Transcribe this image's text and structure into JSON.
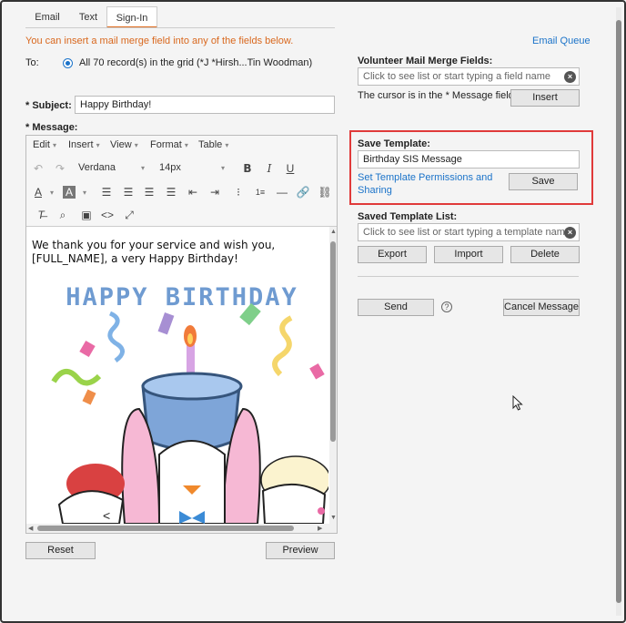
{
  "tabs": [
    {
      "label": "Email"
    },
    {
      "label": "Text"
    },
    {
      "label": "Sign-In"
    }
  ],
  "notice": "You can insert a mail merge field into any of the fields below.",
  "email_queue": "Email Queue",
  "to": {
    "label": "To:",
    "recipients": "All 70 record(s) in the grid (*J *Hirsh...Tin Woodman)"
  },
  "subject": {
    "label": "* Subject:",
    "value": "Happy Birthday!"
  },
  "message": {
    "label": "* Message:",
    "menus": [
      "Edit",
      "Insert",
      "View",
      "Format",
      "Table"
    ],
    "font_family": "Verdana",
    "font_size": "14px",
    "body_text": "We thank you for your service and wish you, [FULL_NAME], a very Happy Birthday!",
    "image_caption": "HAPPY BIRTHDAY"
  },
  "buttons": {
    "reset": "Reset",
    "preview": "Preview",
    "insert": "Insert",
    "save": "Save",
    "export": "Export",
    "import": "Import",
    "delete": "Delete",
    "send": "Send",
    "cancel_message": "Cancel Message"
  },
  "merge_fields": {
    "label": "Volunteer Mail Merge Fields:",
    "placeholder": "Click to see list or start typing a field name",
    "cursor_note": "The cursor is in the * Message field."
  },
  "save_template": {
    "label": "Save Template:",
    "value": "Birthday SIS Message",
    "permissions_link": "Set Template Permissions and Sharing"
  },
  "saved_templates": {
    "label": "Saved Template List:",
    "placeholder": "Click to see list or start typing a template name"
  },
  "colors": {
    "accent": "#d9681e",
    "link": "#1b73c9",
    "highlight": "#e03a3a"
  }
}
